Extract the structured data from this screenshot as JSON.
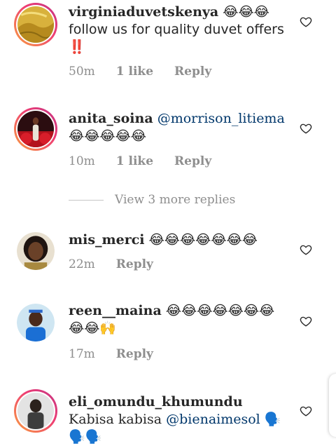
{
  "comments": [
    {
      "username": "virginiaduvetskenya",
      "text": "😂😂😂 follow us for quality duvet offers ‼️",
      "time": "50m",
      "likes": "1 like",
      "reply": "Reply"
    },
    {
      "username": "anita_soina",
      "mention": "@morrison_litiema",
      "text": "😂😂😂😂😂",
      "time": "10m",
      "likes": "1 like",
      "reply": "Reply"
    },
    {
      "username": "mis_merci",
      "text": "😂😂😂😂😂😂😂",
      "time": "22m",
      "reply": "Reply"
    },
    {
      "username": "reen__maina",
      "text": "😂😂😂😂😂😂😂😂😂🙌",
      "time": "17m",
      "reply": "Reply"
    },
    {
      "username": "eli_omundu_khumundu",
      "text_before": "Kabisa kabisa",
      "mention": "@bienaimesol",
      "text_after": "🗣️🗣️🗣️"
    }
  ],
  "view_more": "View 3 more replies",
  "icons": {
    "like": "heart-outline-icon"
  }
}
